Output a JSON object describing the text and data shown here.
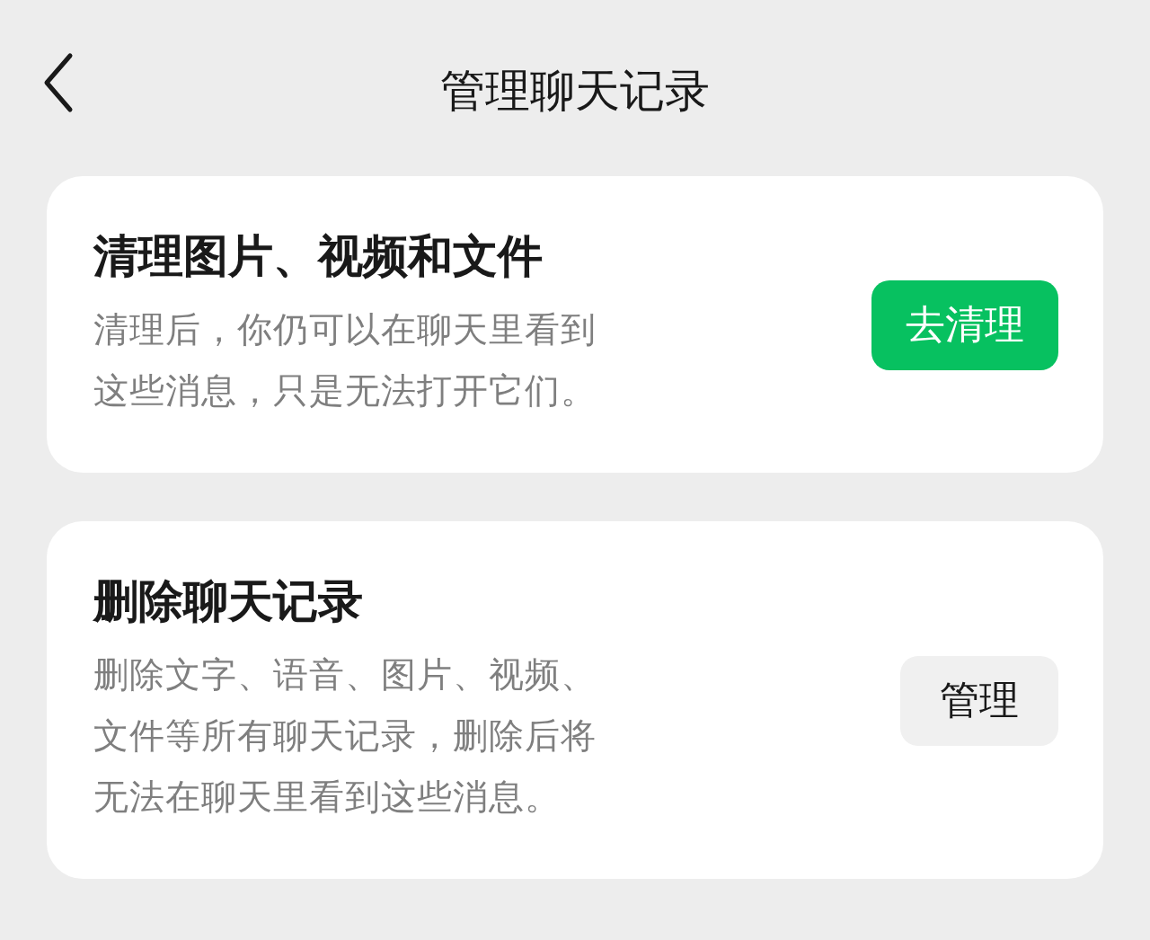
{
  "header": {
    "title": "管理聊天记录"
  },
  "cards": [
    {
      "title": "清理图片、视频和文件",
      "description": "清理后，你仍可以在聊天里看到这些消息，只是无法打开它们。",
      "button": {
        "label": "去清理",
        "kind": "primary"
      }
    },
    {
      "title": "删除聊天记录",
      "description": "删除文字、语音、图片、视频、文件等所有聊天记录，删除后将无法在聊天里看到这些消息。",
      "button": {
        "label": "管理",
        "kind": "secondary"
      }
    }
  ]
}
